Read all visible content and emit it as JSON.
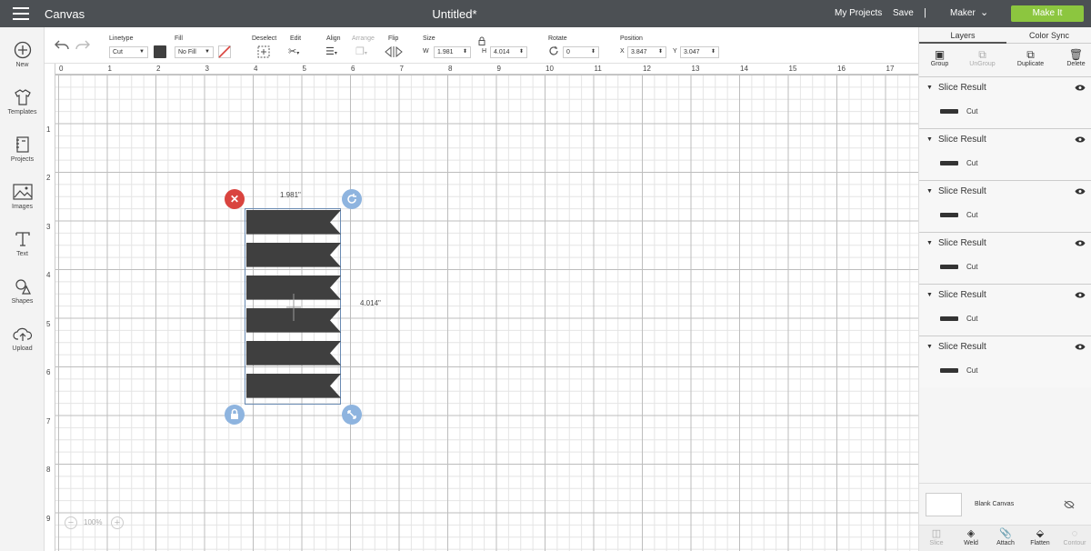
{
  "topbar": {
    "app_title": "Canvas",
    "document_title": "Untitled*",
    "my_projects": "My Projects",
    "save": "Save",
    "separator": "|",
    "machine": "Maker",
    "make_it": "Make It"
  },
  "left_tools": [
    {
      "label": "New",
      "icon": "plus-circle-icon"
    },
    {
      "label": "Templates",
      "icon": "tshirt-icon"
    },
    {
      "label": "Projects",
      "icon": "notebook-icon"
    },
    {
      "label": "Images",
      "icon": "image-icon"
    },
    {
      "label": "Text",
      "icon": "text-t-icon"
    },
    {
      "label": "Shapes",
      "icon": "shapes-icon"
    },
    {
      "label": "Upload",
      "icon": "cloud-upload-icon"
    }
  ],
  "toolbar": {
    "linetype": {
      "label": "Linetype",
      "value": "Cut",
      "color": "#3f3f3f"
    },
    "fill": {
      "label": "Fill",
      "value": "No Fill"
    },
    "deselect": "Deselect",
    "edit": "Edit",
    "align": "Align",
    "arrange": "Arrange",
    "flip": "Flip",
    "size": {
      "label": "Size",
      "w_label": "W",
      "w": "1.981",
      "h_label": "H",
      "h": "4.014"
    },
    "rotate": {
      "label": "Rotate",
      "value": "0"
    },
    "position": {
      "label": "Position",
      "x_label": "X",
      "x": "3.847",
      "y_label": "Y",
      "y": "3.047"
    }
  },
  "rulers": {
    "horizontal": [
      "0",
      "1",
      "2",
      "3",
      "4",
      "5",
      "6",
      "7",
      "8",
      "9",
      "10",
      "11",
      "12",
      "13",
      "14",
      "15",
      "16",
      "17"
    ],
    "vertical": [
      "1",
      "2",
      "3",
      "4",
      "5",
      "6",
      "7",
      "8",
      "9"
    ]
  },
  "selection": {
    "width_label": "1.981\"",
    "height_label": "4.014\"",
    "banner_count": 6,
    "fill_color": "#3f3f3f",
    "handle_delete_color": "#d9443f",
    "handle_color": "#8eb4df"
  },
  "zoom": {
    "minus": "−",
    "value": "100%",
    "plus": "+"
  },
  "right_panel": {
    "tabs": [
      "Layers",
      "Color Sync"
    ],
    "layer_ops": [
      {
        "label": "Group",
        "enabled": true
      },
      {
        "label": "UnGroup",
        "enabled": false
      },
      {
        "label": "Duplicate",
        "enabled": true
      },
      {
        "label": "Delete",
        "enabled": true
      }
    ],
    "layers": [
      {
        "name": "Slice Result",
        "op": "Cut"
      },
      {
        "name": "Slice Result",
        "op": "Cut"
      },
      {
        "name": "Slice Result",
        "op": "Cut"
      },
      {
        "name": "Slice Result",
        "op": "Cut"
      },
      {
        "name": "Slice Result",
        "op": "Cut"
      },
      {
        "name": "Slice Result",
        "op": "Cut"
      }
    ],
    "blank_canvas": "Blank Canvas",
    "bottom_ops": [
      {
        "label": "Slice",
        "enabled": false
      },
      {
        "label": "Weld",
        "enabled": true
      },
      {
        "label": "Attach",
        "enabled": true
      },
      {
        "label": "Flatten",
        "enabled": true
      },
      {
        "label": "Contour",
        "enabled": false
      }
    ]
  }
}
